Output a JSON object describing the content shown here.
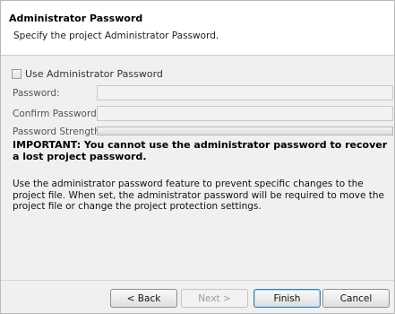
{
  "header": {
    "title": "Administrator Password",
    "subtitle": "Specify the project Administrator Password."
  },
  "form": {
    "use_admin_password_label": "Use Administrator Password",
    "use_admin_password_checked": false,
    "password_label": "Password:",
    "password_value": "",
    "confirm_label": "Confirm Password:",
    "confirm_value": "",
    "strength_label": "Password Strength:",
    "strength_level": 0
  },
  "important_text": "IMPORTANT: You cannot use the administrator password to recover a lost project password.",
  "info_text": "Use the administrator password feature to prevent specific changes to the project file. When set, the administrator password will be required to move the project file or change the project protection settings.",
  "buttons": {
    "back": "< Back",
    "next": "Next >",
    "finish": "Finish",
    "cancel": "Cancel"
  }
}
